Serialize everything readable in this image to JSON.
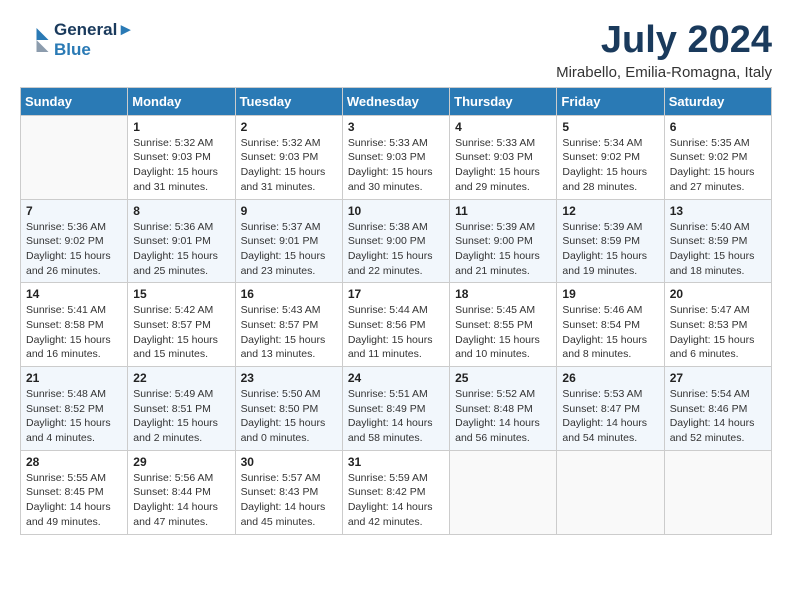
{
  "header": {
    "logo_line1": "General",
    "logo_line2": "Blue",
    "month_title": "July 2024",
    "location": "Mirabello, Emilia-Romagna, Italy"
  },
  "weekdays": [
    "Sunday",
    "Monday",
    "Tuesday",
    "Wednesday",
    "Thursday",
    "Friday",
    "Saturday"
  ],
  "weeks": [
    [
      {
        "day": "",
        "info": ""
      },
      {
        "day": "1",
        "info": "Sunrise: 5:32 AM\nSunset: 9:03 PM\nDaylight: 15 hours\nand 31 minutes."
      },
      {
        "day": "2",
        "info": "Sunrise: 5:32 AM\nSunset: 9:03 PM\nDaylight: 15 hours\nand 31 minutes."
      },
      {
        "day": "3",
        "info": "Sunrise: 5:33 AM\nSunset: 9:03 PM\nDaylight: 15 hours\nand 30 minutes."
      },
      {
        "day": "4",
        "info": "Sunrise: 5:33 AM\nSunset: 9:03 PM\nDaylight: 15 hours\nand 29 minutes."
      },
      {
        "day": "5",
        "info": "Sunrise: 5:34 AM\nSunset: 9:02 PM\nDaylight: 15 hours\nand 28 minutes."
      },
      {
        "day": "6",
        "info": "Sunrise: 5:35 AM\nSunset: 9:02 PM\nDaylight: 15 hours\nand 27 minutes."
      }
    ],
    [
      {
        "day": "7",
        "info": "Sunrise: 5:36 AM\nSunset: 9:02 PM\nDaylight: 15 hours\nand 26 minutes."
      },
      {
        "day": "8",
        "info": "Sunrise: 5:36 AM\nSunset: 9:01 PM\nDaylight: 15 hours\nand 25 minutes."
      },
      {
        "day": "9",
        "info": "Sunrise: 5:37 AM\nSunset: 9:01 PM\nDaylight: 15 hours\nand 23 minutes."
      },
      {
        "day": "10",
        "info": "Sunrise: 5:38 AM\nSunset: 9:00 PM\nDaylight: 15 hours\nand 22 minutes."
      },
      {
        "day": "11",
        "info": "Sunrise: 5:39 AM\nSunset: 9:00 PM\nDaylight: 15 hours\nand 21 minutes."
      },
      {
        "day": "12",
        "info": "Sunrise: 5:39 AM\nSunset: 8:59 PM\nDaylight: 15 hours\nand 19 minutes."
      },
      {
        "day": "13",
        "info": "Sunrise: 5:40 AM\nSunset: 8:59 PM\nDaylight: 15 hours\nand 18 minutes."
      }
    ],
    [
      {
        "day": "14",
        "info": "Sunrise: 5:41 AM\nSunset: 8:58 PM\nDaylight: 15 hours\nand 16 minutes."
      },
      {
        "day": "15",
        "info": "Sunrise: 5:42 AM\nSunset: 8:57 PM\nDaylight: 15 hours\nand 15 minutes."
      },
      {
        "day": "16",
        "info": "Sunrise: 5:43 AM\nSunset: 8:57 PM\nDaylight: 15 hours\nand 13 minutes."
      },
      {
        "day": "17",
        "info": "Sunrise: 5:44 AM\nSunset: 8:56 PM\nDaylight: 15 hours\nand 11 minutes."
      },
      {
        "day": "18",
        "info": "Sunrise: 5:45 AM\nSunset: 8:55 PM\nDaylight: 15 hours\nand 10 minutes."
      },
      {
        "day": "19",
        "info": "Sunrise: 5:46 AM\nSunset: 8:54 PM\nDaylight: 15 hours\nand 8 minutes."
      },
      {
        "day": "20",
        "info": "Sunrise: 5:47 AM\nSunset: 8:53 PM\nDaylight: 15 hours\nand 6 minutes."
      }
    ],
    [
      {
        "day": "21",
        "info": "Sunrise: 5:48 AM\nSunset: 8:52 PM\nDaylight: 15 hours\nand 4 minutes."
      },
      {
        "day": "22",
        "info": "Sunrise: 5:49 AM\nSunset: 8:51 PM\nDaylight: 15 hours\nand 2 minutes."
      },
      {
        "day": "23",
        "info": "Sunrise: 5:50 AM\nSunset: 8:50 PM\nDaylight: 15 hours\nand 0 minutes."
      },
      {
        "day": "24",
        "info": "Sunrise: 5:51 AM\nSunset: 8:49 PM\nDaylight: 14 hours\nand 58 minutes."
      },
      {
        "day": "25",
        "info": "Sunrise: 5:52 AM\nSunset: 8:48 PM\nDaylight: 14 hours\nand 56 minutes."
      },
      {
        "day": "26",
        "info": "Sunrise: 5:53 AM\nSunset: 8:47 PM\nDaylight: 14 hours\nand 54 minutes."
      },
      {
        "day": "27",
        "info": "Sunrise: 5:54 AM\nSunset: 8:46 PM\nDaylight: 14 hours\nand 52 minutes."
      }
    ],
    [
      {
        "day": "28",
        "info": "Sunrise: 5:55 AM\nSunset: 8:45 PM\nDaylight: 14 hours\nand 49 minutes."
      },
      {
        "day": "29",
        "info": "Sunrise: 5:56 AM\nSunset: 8:44 PM\nDaylight: 14 hours\nand 47 minutes."
      },
      {
        "day": "30",
        "info": "Sunrise: 5:57 AM\nSunset: 8:43 PM\nDaylight: 14 hours\nand 45 minutes."
      },
      {
        "day": "31",
        "info": "Sunrise: 5:59 AM\nSunset: 8:42 PM\nDaylight: 14 hours\nand 42 minutes."
      },
      {
        "day": "",
        "info": ""
      },
      {
        "day": "",
        "info": ""
      },
      {
        "day": "",
        "info": ""
      }
    ]
  ]
}
